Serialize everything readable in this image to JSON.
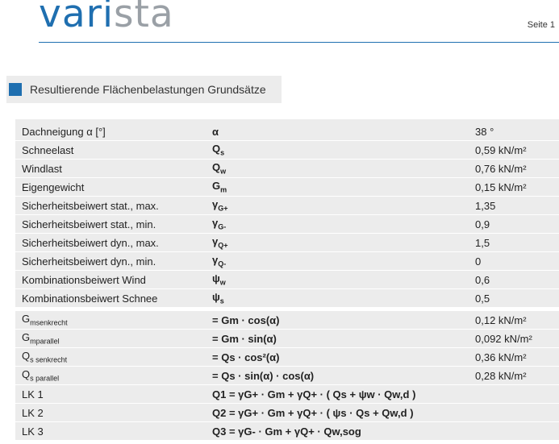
{
  "header": {
    "logo_part1": "vari",
    "logo_part2": "sta",
    "registered": "®",
    "page": "Seite 1"
  },
  "section": {
    "title": "Resultierende Flächenbelastungen Grundsätze"
  },
  "params": [
    {
      "label": "Dachneigung α [°]",
      "symbol": "α",
      "sub": "",
      "value": "38 °"
    },
    {
      "label": "Schneelast",
      "symbol": "Q",
      "sub": "s",
      "value": "0,59 kN/m²"
    },
    {
      "label": "Windlast",
      "symbol": "Q",
      "sub": "w",
      "value": "0,76 kN/m²"
    },
    {
      "label": "Eigengewicht",
      "symbol": "G",
      "sub": "m",
      "value": "0,15 kN/m²"
    },
    {
      "label": "Sicherheitsbeiwert stat., max.",
      "symbol": "γ",
      "sub": "G+",
      "value": "1,35"
    },
    {
      "label": "Sicherheitsbeiwert stat., min.",
      "symbol": "γ",
      "sub": "G-",
      "value": "0,9"
    },
    {
      "label": "Sicherheitsbeiwert dyn., max.",
      "symbol": "γ",
      "sub": "Q+",
      "value": "1,5"
    },
    {
      "label": "Sicherheitsbeiwert dyn., min.",
      "symbol": "γ",
      "sub": "Q-",
      "value": "0"
    },
    {
      "label": "Kombinationsbeiwert Wind",
      "symbol": "ψ",
      "sub": "w",
      "value": "0,6"
    },
    {
      "label": "Kombinationsbeiwert Schnee",
      "symbol": "ψ",
      "sub": "s",
      "value": "0,5"
    }
  ],
  "formulas": [
    {
      "label_main": "G",
      "label_sub": "msenkrecht",
      "formula": "= Gm · cos(α)",
      "value": "0,12 kN/m²"
    },
    {
      "label_main": "G",
      "label_sub": "mparallel",
      "formula": "= Gm · sin(α)",
      "value": "0,092 kN/m²"
    },
    {
      "label_main": "Q",
      "label_sub": "s senkrecht",
      "formula": "= Qs · cos²(α)",
      "value": "0,36 kN/m²"
    },
    {
      "label_main": "Q",
      "label_sub": "s parallel",
      "formula": "= Qs · sin(α) · cos(α)",
      "value": "0,28 kN/m²"
    },
    {
      "label_main": "LK 1",
      "label_sub": "",
      "formula": "Q1 = γG+ · Gm + γQ+ · ( Qs + ψw · Qw,d )",
      "value": ""
    },
    {
      "label_main": "LK 2",
      "label_sub": "",
      "formula": "Q2 = γG+ · Gm + γQ+ · ( ψs · Qs + Qw,d )",
      "value": ""
    },
    {
      "label_main": "LK 3",
      "label_sub": "",
      "formula": "Q3 = γG- · Gm + γQ+ · Qw,sog",
      "value": ""
    }
  ]
}
